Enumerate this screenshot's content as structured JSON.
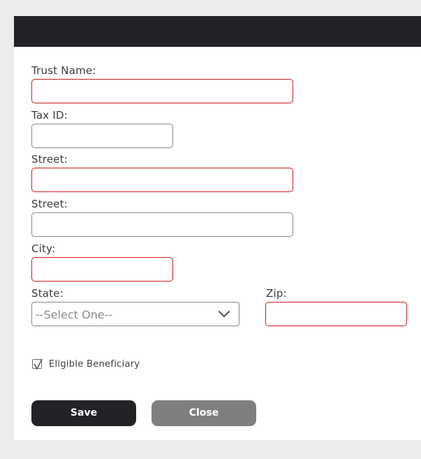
{
  "dialog": {
    "title": ""
  },
  "form": {
    "trust_name": {
      "label": "Trust Name:",
      "value": ""
    },
    "tax_id": {
      "label": "Tax ID:",
      "value": ""
    },
    "street1": {
      "label": "Street:",
      "value": ""
    },
    "street2": {
      "label": "Street:",
      "value": ""
    },
    "city": {
      "label": "City:",
      "value": ""
    },
    "state": {
      "label": "State:",
      "selected": "--Select One--"
    },
    "zip": {
      "label": "Zip:",
      "value": ""
    },
    "eligible_beneficiary": {
      "label": "Eligible Beneficiary",
      "checked": true
    }
  },
  "buttons": {
    "save": "Save",
    "close": "Close"
  },
  "colors": {
    "titlebar": "#212327",
    "required_border": "#d01c1c",
    "save_button": "#212327",
    "close_button": "#7f7f7f"
  },
  "icons": {
    "state_dropdown": "chevron-down-icon",
    "checkbox_mark": "checkmark-icon"
  }
}
